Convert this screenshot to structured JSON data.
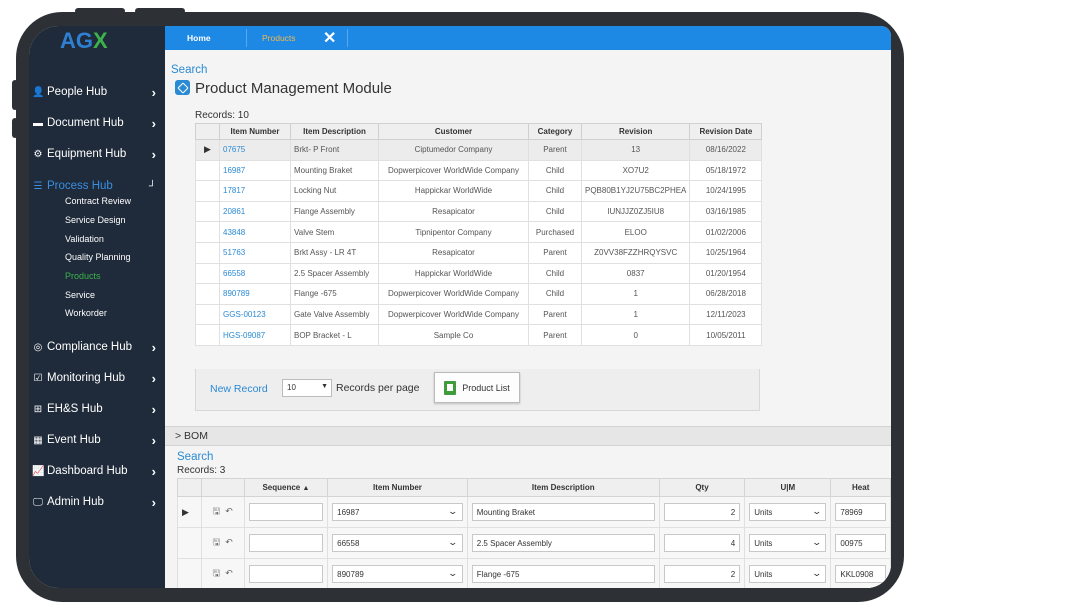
{
  "brand": {
    "logo_ag": "AG",
    "logo_x": "X"
  },
  "sidebar": {
    "items": [
      {
        "label": "People Hub",
        "icon": "person-icon",
        "glyph": "👤"
      },
      {
        "label": "Document Hub",
        "icon": "folder-icon",
        "glyph": "▬"
      },
      {
        "label": "Equipment Hub",
        "icon": "gears-icon",
        "glyph": "⚙"
      },
      {
        "label": "Process Hub",
        "icon": "list-icon",
        "glyph": "☰"
      },
      {
        "label": "Compliance Hub",
        "icon": "compliance-icon",
        "glyph": "◎"
      },
      {
        "label": "Monitoring Hub",
        "icon": "checkbox-icon",
        "glyph": "☑"
      },
      {
        "label": "EH&S Hub",
        "icon": "plus-square-icon",
        "glyph": "⊞"
      },
      {
        "label": "Event Hub",
        "icon": "calendar-icon",
        "glyph": "▦"
      },
      {
        "label": "Dashboard Hub",
        "icon": "chart-icon",
        "glyph": "📈"
      },
      {
        "label": "Admin Hub",
        "icon": "monitor-icon",
        "glyph": "🖵"
      }
    ],
    "process_sub": [
      "Contract Review",
      "Service Design",
      "Validation",
      "Quality Planning",
      "Products",
      "Service",
      "Workorder"
    ],
    "active_sub": "Products"
  },
  "topbar": {
    "tabs": [
      "Home",
      "Products"
    ],
    "close_glyph": "✕"
  },
  "products": {
    "search_label": "Search",
    "title": "Product Management Module",
    "records_label": "Records:  10",
    "columns": [
      "Item Number",
      "Item Description",
      "Customer",
      "Category",
      "Revision",
      "Revision Date"
    ],
    "rows": [
      [
        "07675",
        "Brkt- P Front",
        "Ciptumedor Company",
        "Parent",
        "13",
        "08/16/2022"
      ],
      [
        "16987",
        "Mounting Braket",
        "Dopwerpicover WorldWide Company",
        "Child",
        "XO7U2",
        "05/18/1972"
      ],
      [
        "17817",
        "Locking Nut",
        "Happickar WorldWide",
        "Child",
        "PQB80B1YJ2U75BC2PHEA",
        "10/24/1995"
      ],
      [
        "20861",
        "Flange Assembly",
        "Resapicator",
        "Child",
        "IUNJJZ0ZJ5IU8",
        "03/16/1985"
      ],
      [
        "43848",
        "Valve Stem",
        "Tipnipentor Company",
        "Purchased",
        "ELOO",
        "01/02/2006"
      ],
      [
        "51763",
        "Brkt Assy - LR 4T",
        "Resapicator",
        "Parent",
        "Z0VV38FZZHRQYSVC",
        "10/25/1964"
      ],
      [
        "66558",
        "2.5 Spacer Assembly",
        "Happickar WorldWide",
        "Child",
        "0837",
        "01/20/1954"
      ],
      [
        "890789",
        "Flange -675",
        "Dopwerpicover WorldWide Company",
        "Child",
        "1",
        "06/28/2018"
      ],
      [
        "GGS-00123",
        "Gate Valve Assembly",
        "Dopwerpicover WorldWide Company",
        "Parent",
        "1",
        "12/11/2023"
      ],
      [
        "HGS-09087",
        "BOP Bracket - L",
        "Sample Co",
        "Parent",
        "0",
        "10/05/2011"
      ]
    ],
    "new_record": "New Record",
    "per_page_value": "10",
    "per_page_label": "Records per page",
    "product_list_button": "Product List"
  },
  "bom": {
    "section_label": "> BOM",
    "search_label": "Search",
    "records_label": "Records:  3",
    "columns": [
      "Sequence",
      "Item Number",
      "Item Description",
      "Qty",
      "U|M",
      "Heat"
    ],
    "sort_indicator": "▲",
    "rows": [
      {
        "sequence": "",
        "item": "16987",
        "desc": "Mounting Braket",
        "qty": "2",
        "um": "Units",
        "heat": "78969"
      },
      {
        "sequence": "",
        "item": "66558",
        "desc": "2.5 Spacer Assembly",
        "qty": "4",
        "um": "Units",
        "heat": "00975"
      },
      {
        "sequence": "",
        "item": "890789",
        "desc": "Flange -675",
        "qty": "2",
        "um": "Units",
        "heat": "KKL0908"
      }
    ]
  }
}
